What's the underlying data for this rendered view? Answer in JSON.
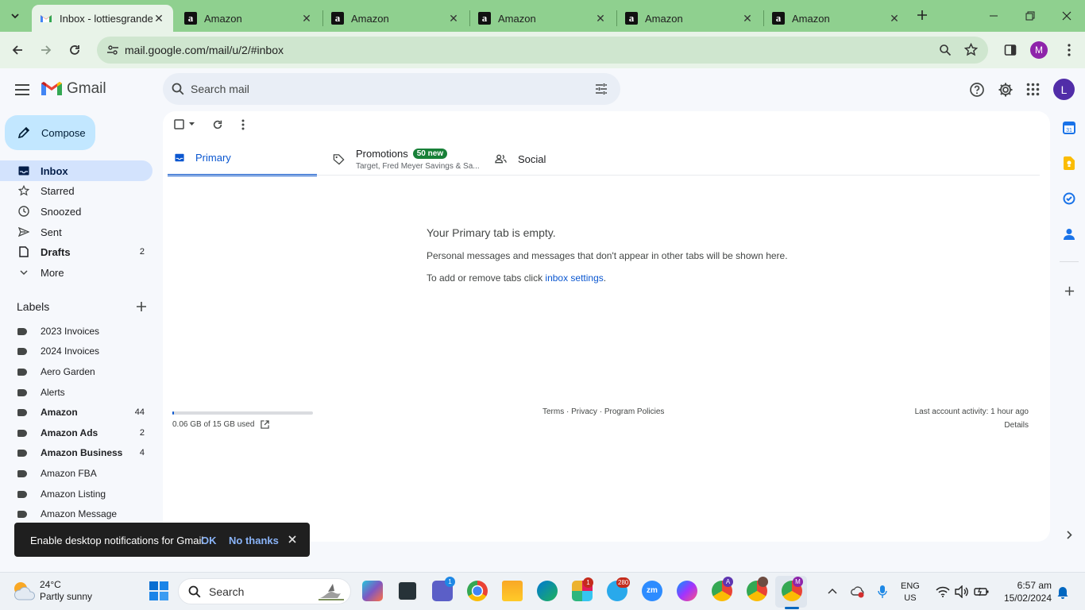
{
  "browser": {
    "tabs": [
      {
        "title": "Inbox - lottiesgrande",
        "favicon": "gmail-icon",
        "active": true
      },
      {
        "title": "Amazon",
        "favicon": "amazon-icon"
      },
      {
        "title": "Amazon",
        "favicon": "amazon-icon"
      },
      {
        "title": "Amazon",
        "favicon": "amazon-icon"
      },
      {
        "title": "Amazon",
        "favicon": "amazon-icon"
      },
      {
        "title": "Amazon",
        "favicon": "amazon-icon"
      }
    ],
    "url": "mail.google.com/mail/u/2/#inbox",
    "profile_initial": "M"
  },
  "gmail": {
    "logo_text": "Gmail",
    "search_placeholder": "Search mail",
    "account_initial": "L",
    "compose_label": "Compose",
    "nav": [
      {
        "label": "Inbox",
        "icon": "inbox-icon",
        "count": ""
      },
      {
        "label": "Starred",
        "icon": "star-icon",
        "count": ""
      },
      {
        "label": "Snoozed",
        "icon": "clock-icon",
        "count": ""
      },
      {
        "label": "Sent",
        "icon": "send-icon",
        "count": ""
      },
      {
        "label": "Drafts",
        "icon": "draft-icon",
        "count": "2"
      },
      {
        "label": "More",
        "icon": "chevron-down-icon",
        "count": ""
      }
    ],
    "labels_heading": "Labels",
    "labels": [
      {
        "label": "2023 Invoices",
        "count": ""
      },
      {
        "label": "2024 Invoices",
        "count": ""
      },
      {
        "label": "Aero Garden",
        "count": ""
      },
      {
        "label": "Alerts",
        "count": ""
      },
      {
        "label": "Amazon",
        "count": "44"
      },
      {
        "label": "Amazon Ads",
        "count": "2"
      },
      {
        "label": "Amazon Business",
        "count": "4"
      },
      {
        "label": "Amazon FBA",
        "count": ""
      },
      {
        "label": "Amazon Listing",
        "count": ""
      },
      {
        "label": "Amazon Message",
        "count": ""
      }
    ],
    "tabs": {
      "primary": "Primary",
      "promotions": "Promotions",
      "promotions_badge": "50 new",
      "promotions_snippet": "Target, Fred Meyer Savings & Sa...",
      "social": "Social"
    },
    "empty": {
      "title": "Your Primary tab is empty.",
      "line1": "Personal messages and messages that don't appear in other tabs will be shown here.",
      "line2_prefix": "To add or remove tabs click ",
      "line2_link": "inbox settings",
      "line2_suffix": "."
    },
    "footer": {
      "storage": "0.06 GB of 15 GB used",
      "storage_fraction": 0.004,
      "terms": "Terms",
      "privacy": "Privacy",
      "policies": "Program Policies",
      "sep": " · ",
      "activity": "Last account activity: 1 hour ago",
      "details": "Details"
    },
    "snackbar": {
      "message": "Enable desktop notifications for Gmail.",
      "ok": "OK",
      "no_thanks": "No thanks"
    }
  },
  "taskbar": {
    "weather_temp": "24°C",
    "weather_desc": "Partly sunny",
    "search_label": "Search",
    "lang": "ENG",
    "region": "US",
    "time": "6:57 am",
    "date": "15/02/2024",
    "badges": {
      "teams": "1",
      "slack": "1",
      "telegram": "280"
    },
    "chrome_profiles": [
      "A",
      "M"
    ]
  },
  "colors": {
    "tabstrip": "#8fd08f",
    "toolbar": "#e8f3e8",
    "primary_blue": "#0b57d0",
    "compose": "#c2e7ff",
    "nav_selected": "#d3e3fd",
    "promo_badge": "#188038"
  }
}
